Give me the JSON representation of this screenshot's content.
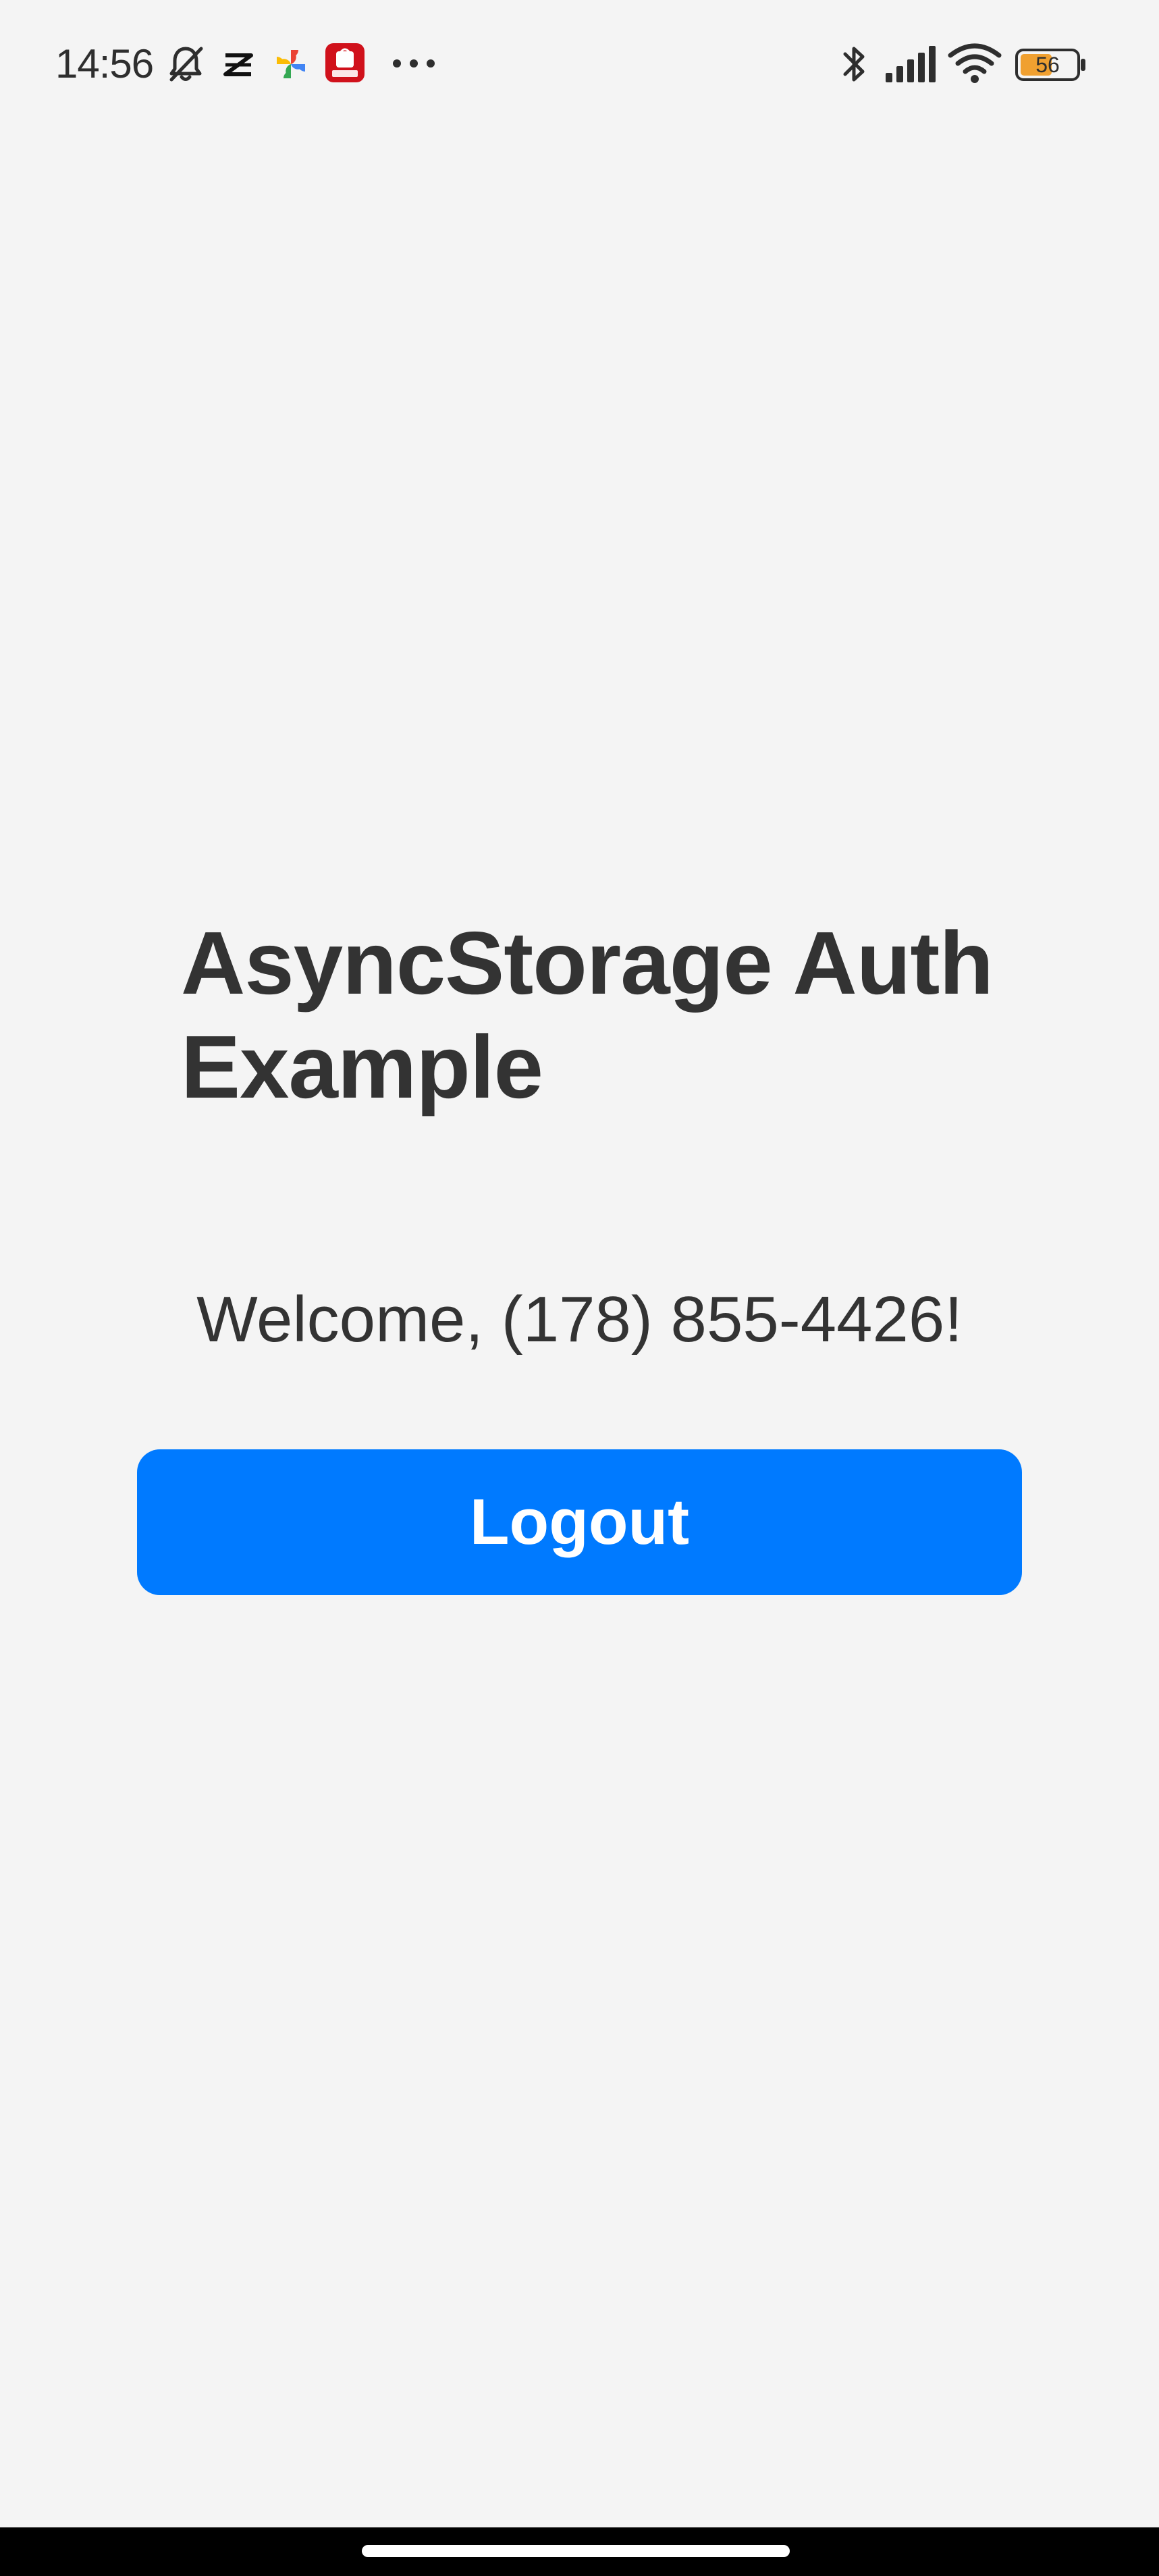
{
  "status_bar": {
    "time": "14:56",
    "battery_level": "56",
    "battery_color": "#f0a030",
    "left_icons": [
      "bell-muted-icon",
      "capcut-icon",
      "pinwheel-icon",
      "shopee-icon",
      "more-dots-icon"
    ],
    "right_icons": [
      "bluetooth-icon",
      "signal-icon",
      "wifi-icon",
      "battery-icon"
    ]
  },
  "main": {
    "title": "AsyncStorage Auth Example",
    "welcome_text": "Welcome, (178) 855-4426!",
    "logout_label": "Logout"
  },
  "colors": {
    "background": "#f4f4f4",
    "accent": "#007aff",
    "text": "#333333",
    "nav_bar": "#000000"
  }
}
